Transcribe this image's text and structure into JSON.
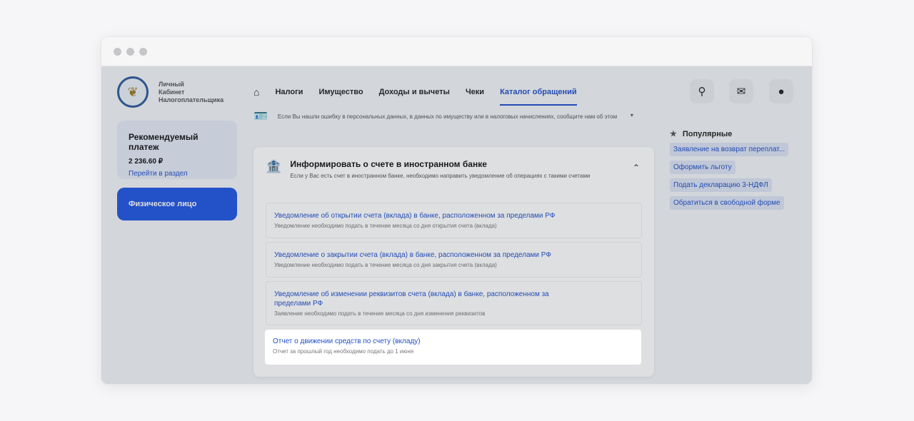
{
  "brand": {
    "line1": "Личный",
    "line2": "Кабинет",
    "line3": "Налогоплательщика"
  },
  "nav": {
    "items": [
      "Налоги",
      "Имущество",
      "Доходы и вычеты",
      "Чеки",
      "Каталог обращений"
    ],
    "active": "Каталог обращений"
  },
  "payment": {
    "title": "Рекомендуемый платеж",
    "amount": "2 236.60 ₽",
    "link": "Перейти в раздел"
  },
  "profile_button": "Физическое лицо",
  "prev_section": {
    "desc": "Если Вы нашли ошибку в персональных данных, в данных по имуществу или в налоговых начислениях, сообщите нам об этом"
  },
  "panel": {
    "title": "Информировать о счете в иностранном банке",
    "subtitle": "Если у Вас есть счет в иностранном банке, необходимо направить уведомление об операциях с такими счетами",
    "items": [
      {
        "title": "Уведомление об открытии счета (вклада) в банке, расположенном за пределами РФ",
        "desc": "Уведомление необходимо подать в течение месяца со дня открытия счета (вклада)"
      },
      {
        "title": "Уведомление о закрытии счета (вклада) в банке, расположенном за пределами РФ",
        "desc": "Уведомление необходимо подать в течение месяца со дня закрытия счета (вклада)"
      },
      {
        "title": "Уведомление об изменении реквизитов счета (вклада) в банке, расположенном за пределами РФ",
        "desc": "Заявление необходимо подать в течение месяца со дня изменения реквизитов"
      },
      {
        "title": "Отчет о движении средств по счету (вкладу)",
        "desc": "Отчет за прошлый год необходимо подать до 1 июня"
      }
    ]
  },
  "popular": {
    "title": "Популярные",
    "items": [
      "Заявление на возврат переплат...",
      "Оформить льготу",
      "Подать декларацию 3-НДФЛ",
      "Обратиться в свободной форме"
    ]
  },
  "colors": {
    "accent": "#1f4fc9",
    "primary_button": "#1f55e0"
  }
}
